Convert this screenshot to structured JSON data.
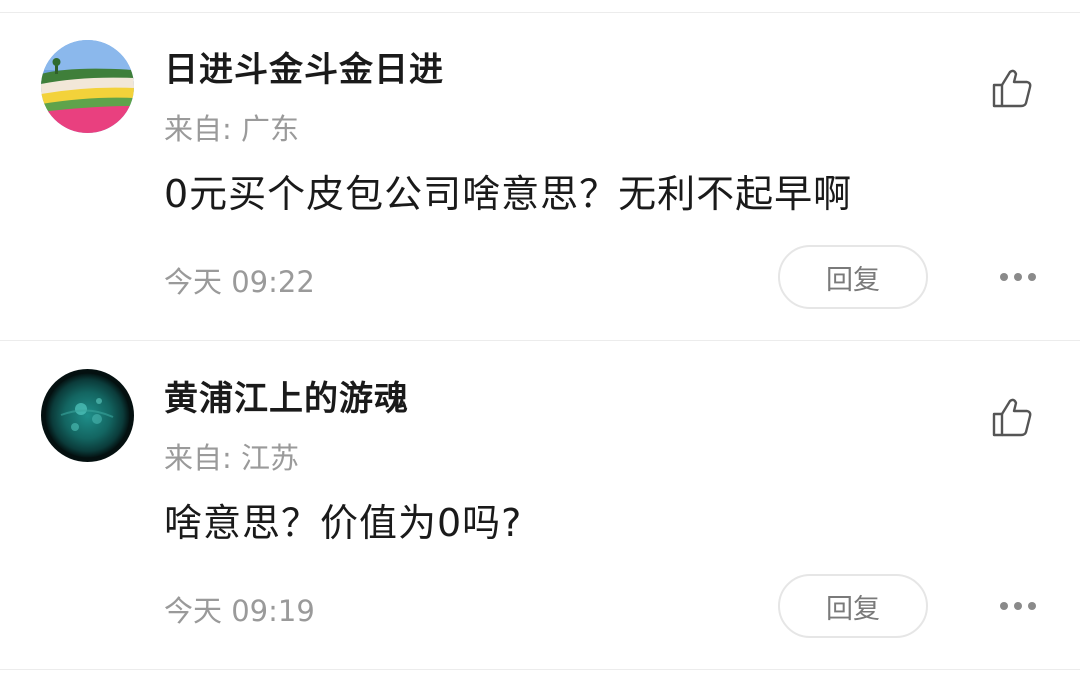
{
  "comments": [
    {
      "username": "日进斗金斗金日进",
      "location": "来自: 广东",
      "content": "0元买个皮包公司啥意思？无利不起早啊",
      "time": "今天 09:22",
      "reply_label": "回复",
      "avatar_icon": "flower-field-avatar",
      "like_icon": "thumbs-up-icon",
      "more_icon": "more-dots-icon"
    },
    {
      "username": "黄浦江上的游魂",
      "location": "来自: 江苏",
      "content": "啥意思？价值为0吗?",
      "time": "今天 09:19",
      "reply_label": "回复",
      "avatar_icon": "sun-avatar",
      "like_icon": "thumbs-up-icon",
      "more_icon": "more-dots-icon"
    }
  ],
  "colors": {
    "text_primary": "#1a1a1a",
    "text_secondary": "#9a9a9a",
    "divider": "#ececec"
  }
}
